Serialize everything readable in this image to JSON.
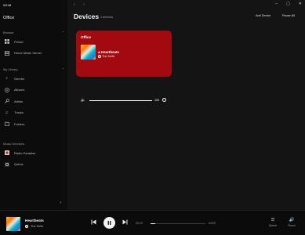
{
  "app": {
    "logo": "WiiM"
  },
  "window": {
    "back": "‹",
    "forward": "›",
    "min": "–",
    "max": "▢",
    "close": "✕"
  },
  "sidebar": {
    "room": "Office",
    "browse": {
      "label": "Browse",
      "items": [
        {
          "label": "Preset",
          "icon": "grid-icon"
        },
        {
          "label": "Home Music Server",
          "icon": "server-icon"
        }
      ]
    },
    "library": {
      "label": "My Library",
      "items": [
        {
          "label": "Genres",
          "icon": "music-note-icon"
        },
        {
          "label": "Albums",
          "icon": "album-icon"
        },
        {
          "label": "Artists",
          "icon": "artist-icon"
        },
        {
          "label": "Tracks",
          "icon": "track-icon"
        },
        {
          "label": "Folders",
          "icon": "folder-icon"
        }
      ]
    },
    "services": {
      "label": "Music Services",
      "items": [
        {
          "label": "Radio Paradise",
          "icon": "radio-paradise-icon"
        },
        {
          "label": "Qobuz",
          "icon": "qobuz-icon"
        }
      ]
    },
    "help": "?"
  },
  "header": {
    "title": "Devices",
    "count": "1 devices",
    "add_device": "Add Device",
    "pause_all": "Pause All"
  },
  "device_card": {
    "room": "Office",
    "track": "Heartbeats",
    "artist": "The Knife",
    "volume": 100,
    "volume_label": "100",
    "accent": "#a30a10"
  },
  "player": {
    "title": "Heartbeats",
    "artist": "The Knife",
    "elapsed": "00:19",
    "duration": "04:03",
    "progress": 0.08,
    "queue_label": "Queue",
    "room_label": "Room"
  }
}
